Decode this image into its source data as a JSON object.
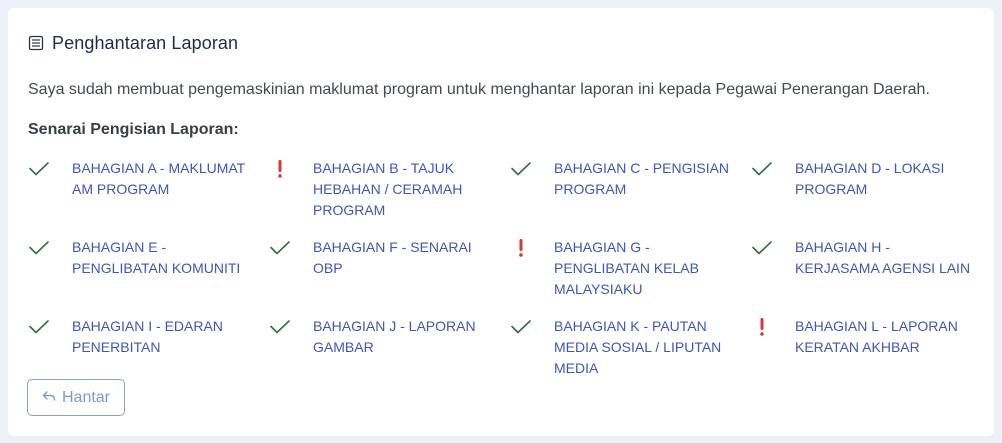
{
  "header": {
    "title": "Penghantaran Laporan",
    "icon": "report-icon"
  },
  "intro": "Saya sudah membuat pengemaskinian maklumat program untuk menghantar laporan ini kepada Pegawai Penerangan Daerah.",
  "list_title": "Senarai Pengisian Laporan:",
  "colors": {
    "ok": "#2e6f4a",
    "warn": "#d9363e",
    "link": "#3d57b8"
  },
  "sections": [
    {
      "label": "BAHAGIAN A - MAKLUMAT AM PROGRAM",
      "status": "complete"
    },
    {
      "label": "BAHAGIAN B - TAJUK HEBAHAN / CERAMAH PROGRAM",
      "status": "incomplete"
    },
    {
      "label": "BAHAGIAN C - PENGISIAN PROGRAM",
      "status": "complete"
    },
    {
      "label": "BAHAGIAN D - LOKASI PROGRAM",
      "status": "complete"
    },
    {
      "label": "BAHAGIAN E - PENGLIBATAN KOMUNITI",
      "status": "complete"
    },
    {
      "label": "BAHAGIAN F - SENARAI OBP",
      "status": "complete"
    },
    {
      "label": "BAHAGIAN G - PENGLIBATAN KELAB MALAYSIAKU",
      "status": "incomplete"
    },
    {
      "label": "BAHAGIAN H - KERJASAMA AGENSI LAIN",
      "status": "complete"
    },
    {
      "label": "BAHAGIAN I - EDARAN PENERBITAN",
      "status": "complete"
    },
    {
      "label": "BAHAGIAN J - LAPORAN GAMBAR",
      "status": "complete"
    },
    {
      "label": "BAHAGIAN K - PAUTAN MEDIA SOSIAL / LIPUTAN MEDIA",
      "status": "complete"
    },
    {
      "label": "BAHAGIAN L - LAPORAN KERATAN AKHBAR",
      "status": "incomplete"
    }
  ],
  "submit": {
    "label": "Hantar",
    "icon": "reply-icon"
  }
}
